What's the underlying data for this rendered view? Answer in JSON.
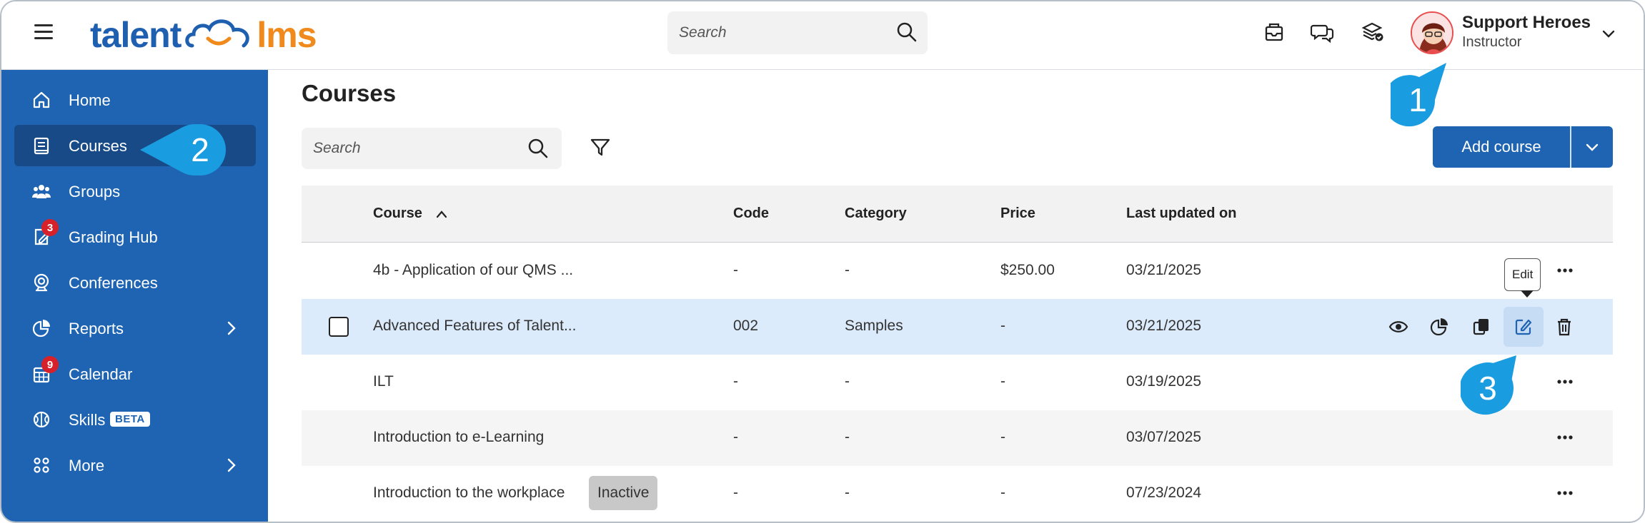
{
  "header": {
    "logo_left": "talent",
    "logo_right": "lms",
    "search_placeholder": "Search",
    "user_name": "Support Heroes",
    "user_role": "Instructor"
  },
  "sidebar": {
    "items": [
      {
        "label": "Home",
        "icon": "home-icon"
      },
      {
        "label": "Courses",
        "icon": "courses-icon",
        "active": true
      },
      {
        "label": "Groups",
        "icon": "groups-icon"
      },
      {
        "label": "Grading Hub",
        "icon": "grading-icon",
        "badge": "3"
      },
      {
        "label": "Conferences",
        "icon": "conferences-icon"
      },
      {
        "label": "Reports",
        "icon": "reports-icon",
        "has_submenu": true
      },
      {
        "label": "Calendar",
        "icon": "calendar-icon",
        "badge": "9"
      },
      {
        "label": "Skills",
        "icon": "skills-icon",
        "tag": "BETA"
      },
      {
        "label": "More",
        "icon": "more-grid-icon",
        "has_submenu": true
      }
    ]
  },
  "main": {
    "title": "Courses",
    "search_placeholder": "Search",
    "add_course_label": "Add course",
    "columns": [
      "Course",
      "Code",
      "Category",
      "Price",
      "Last updated on"
    ],
    "rows": [
      {
        "course": "4b - Application of our QMS ...",
        "code": "-",
        "category": "-",
        "price": "$250.00",
        "updated": "03/21/2025"
      },
      {
        "course": "Advanced Features of Talent...",
        "code": "002",
        "category": "Samples",
        "price": "-",
        "updated": "03/21/2025"
      },
      {
        "course": "ILT",
        "code": "-",
        "category": "-",
        "price": "-",
        "updated": "03/19/2025"
      },
      {
        "course": "Introduction to e-Learning",
        "code": "-",
        "category": "-",
        "price": "-",
        "updated": "03/07/2025"
      },
      {
        "course": "Introduction to the workplace",
        "code": "-",
        "category": "-",
        "price": "-",
        "updated": "07/23/2024",
        "status": "Inactive"
      }
    ],
    "tooltip": "Edit"
  },
  "callouts": [
    "1",
    "2",
    "3"
  ],
  "colors": {
    "brand_blue": "#1f64b2",
    "sidebar_active": "#174a86",
    "callout_blue": "#1a9ce0",
    "logo_orange": "#f08a1c",
    "badge_red": "#d6202a",
    "hover_row": "#dcebfb"
  }
}
